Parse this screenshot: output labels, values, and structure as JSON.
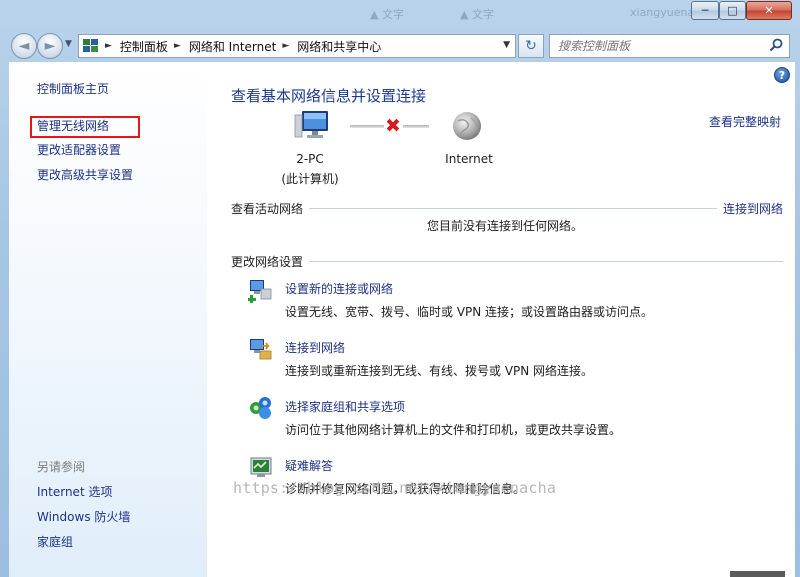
{
  "titlebar": {
    "minimize": "─",
    "maximize": "□",
    "close": "✕",
    "ghost": [
      "▲ 文字",
      "▲ 文字",
      "xiangyuenacha"
    ]
  },
  "nav": {
    "back_glyph": "◄",
    "forward_glyph": "►",
    "breadcrumb": [
      "控制面板",
      "网络和 Internet",
      "网络和共享中心"
    ],
    "separator": "►",
    "refresh_glyph": "↻",
    "search_placeholder": "搜索控制面板"
  },
  "sidebar": {
    "home": "控制面板主页",
    "links": [
      "管理无线网络",
      "更改适配器设置",
      "更改高级共享设置"
    ],
    "see_also_heading": "另请参阅",
    "see_also": [
      "Internet 选项",
      "Windows 防火墙",
      "家庭组"
    ]
  },
  "main": {
    "help_glyph": "?",
    "title": "查看基本网络信息并设置连接",
    "full_map_link": "查看完整映射",
    "computer_name": "2-PC",
    "computer_sub": "(此计算机)",
    "internet_label": "Internet",
    "broken_glyph": "✖",
    "active_networks_heading": "查看活动网络",
    "connect_link": "连接到网络",
    "no_connection_text": "您目前没有连接到任何网络。",
    "change_settings_heading": "更改网络设置",
    "tasks": [
      {
        "icon": "new-connection-icon",
        "link": "设置新的连接或网络",
        "desc": "设置无线、宽带、拨号、临时或 VPN 连接；或设置路由器或访问点。"
      },
      {
        "icon": "connect-network-icon",
        "link": "连接到网络",
        "desc": "连接到或重新连接到无线、有线、拨号或 VPN 网络连接。"
      },
      {
        "icon": "homegroup-icon",
        "link": "选择家庭组和共享选项",
        "desc": "访问位于其他网络计算机上的文件和打印机，或更改共享设置。"
      },
      {
        "icon": "troubleshoot-icon",
        "link": "疑难解答",
        "desc": "诊断并修复网络问题，或获得故障排除信息。"
      }
    ]
  },
  "watermark": "https://blog.csdn.net/xiangyuenacha",
  "colors": {
    "link": "#1e3287",
    "title": "#1c3a94",
    "highlight": "#e8161b"
  }
}
